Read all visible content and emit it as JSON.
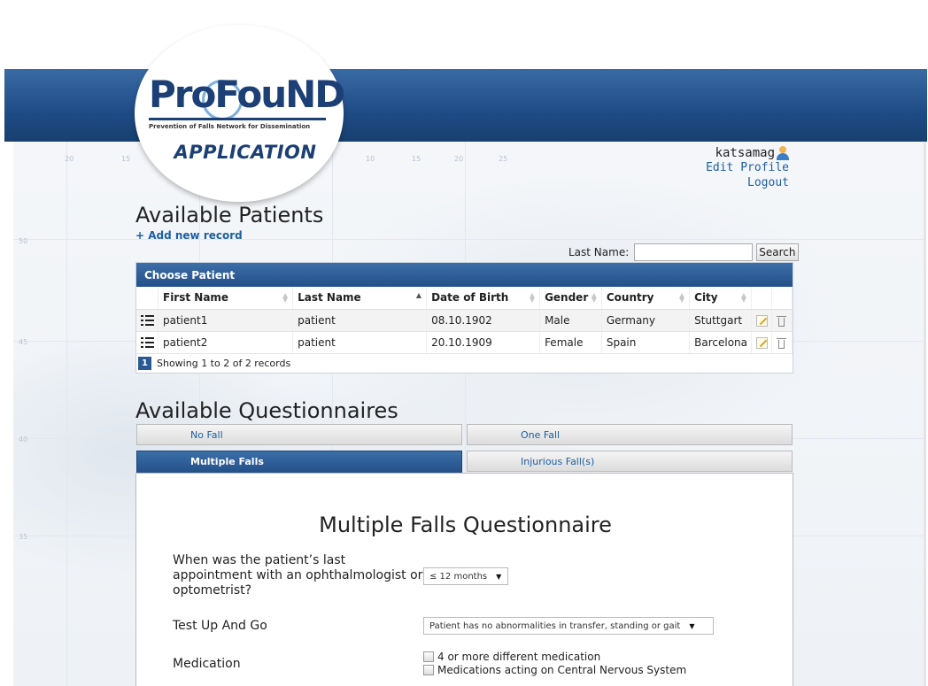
{
  "logo": {
    "brand": "ProFouND",
    "tagline": "Prevention of Falls Network for Dissemination",
    "app_label": "APPLICATION"
  },
  "map_scale": {
    "top": [
      "20",
      "15",
      "10",
      "15",
      "20",
      "25"
    ],
    "left": [
      "50",
      "45",
      "40",
      "35"
    ]
  },
  "user": {
    "name": "katsamag",
    "edit_profile": "Edit Profile",
    "logout": "Logout"
  },
  "patients_section": {
    "title": "Available Patients",
    "add_link": "+ Add new record",
    "search_label": "Last Name:",
    "search_value": "",
    "search_button": "Search",
    "table_title": "Choose Patient",
    "columns": [
      "First Name",
      "Last Name",
      "Date of Birth",
      "Gender",
      "Country",
      "City"
    ],
    "rows": [
      {
        "first": "patient1",
        "last": "patient",
        "dob": "08.10.1902",
        "gender": "Male",
        "country": "Germany",
        "city": "Stuttgart"
      },
      {
        "first": "patient2",
        "last": "patient",
        "dob": "20.10.1909",
        "gender": "Female",
        "country": "Spain",
        "city": "Barcelona"
      }
    ],
    "page": "1",
    "showing": "Showing 1 to 2 of 2 records"
  },
  "questionnaires_section": {
    "title": "Available Questionnaires",
    "tabs": [
      "No Fall",
      "One Fall",
      "Multiple Falls",
      "Injurious Fall(s)"
    ],
    "active_tab": "Multiple Falls",
    "form_title": "Multiple Falls Questionnaire",
    "questions": [
      {
        "label": "When was the patient’s last appointment with an ophthalmologist or optometrist?",
        "select_value": "≤ 12 months"
      },
      {
        "label": "Test Up And Go",
        "select_value": "Patient has no abnormalities in transfer, standing or gait"
      },
      {
        "label": "Medication",
        "options": [
          "4 or more different medication",
          "Medications acting on Central Nervous System"
        ]
      }
    ]
  },
  "colors": {
    "header_blue": "#1f4b86",
    "link_blue": "#1d5fa3",
    "brand_navy": "#1c3f75"
  }
}
